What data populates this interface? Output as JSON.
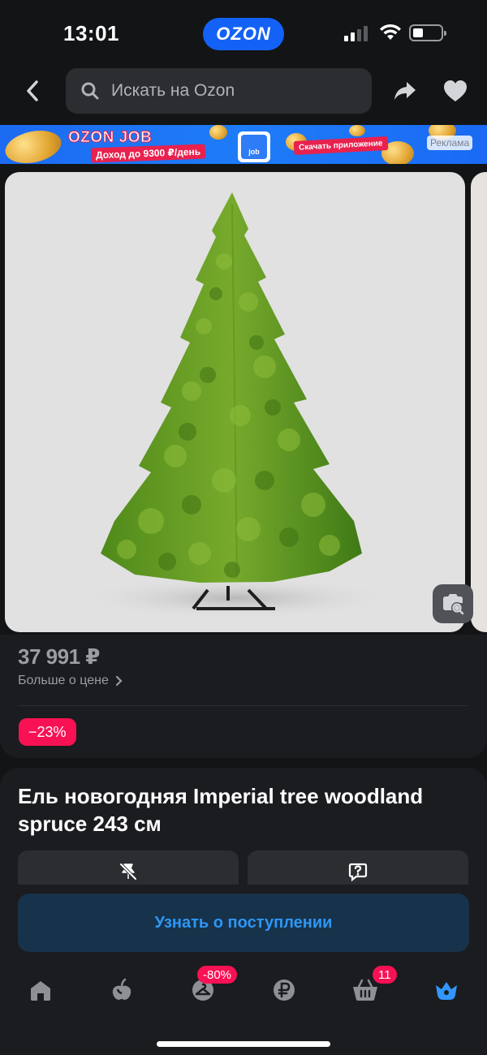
{
  "status_bar": {
    "time": "13:01",
    "app_pill": "OZON"
  },
  "top_nav": {
    "search_placeholder": "Искать на Ozon",
    "icons": [
      "back-icon",
      "search-icon",
      "share-icon",
      "heart-icon"
    ]
  },
  "ad_banner": {
    "title": "OZON JOB",
    "subtitle": "Доход до 9300 ₽/день",
    "phone_text": "job",
    "cta": "Скачать приложение",
    "label": "Реклама"
  },
  "gallery": {
    "visual_search_icon": "visual-search-icon"
  },
  "price": {
    "value": "37 991 ₽",
    "more_label": "Больше о цене",
    "discount": "−23%"
  },
  "product": {
    "title": "Ель новогодняя Imperial tree woodland spruce 243 см",
    "notify_label": "Узнать о поступлении"
  },
  "tab_bar": {
    "items": [
      {
        "name": "home",
        "icon": "home-icon",
        "badge": ""
      },
      {
        "name": "catalog",
        "icon": "catalog-icon",
        "badge": ""
      },
      {
        "name": "fresh",
        "icon": "hanger-icon",
        "badge": "-80%"
      },
      {
        "name": "finance",
        "icon": "ruble-icon",
        "badge": ""
      },
      {
        "name": "cart",
        "icon": "cart-icon",
        "badge": "11"
      },
      {
        "name": "profile",
        "icon": "crown-icon",
        "badge": ""
      }
    ]
  },
  "colors": {
    "background": "#131416",
    "accent_blue": "#1362f5",
    "discount_pink": "#f91155",
    "notify_text": "#2d97f5"
  }
}
